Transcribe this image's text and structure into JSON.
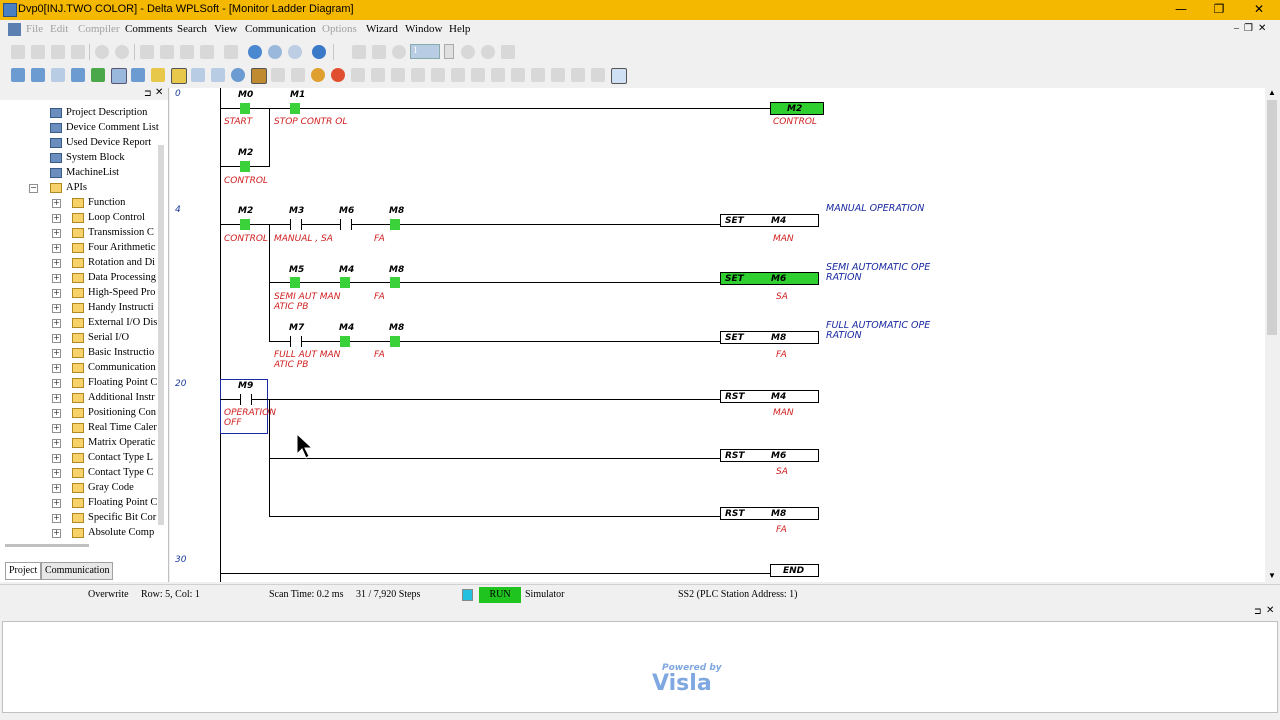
{
  "window": {
    "title": "Dvp0[INJ.TWO COLOR] - Delta WPLSoft - [Monitor Ladder Diagram]",
    "minimize": "—",
    "maximize": "❐",
    "close": "✕"
  },
  "menu": {
    "file": "File",
    "edit": "Edit",
    "compiler": "Compiler",
    "comments": "Comments",
    "search": "Search",
    "view": "View",
    "communication": "Communication",
    "options": "Options",
    "wizard": "Wizard",
    "window": "Window",
    "help": "Help"
  },
  "toolbar": {
    "step_value": "1"
  },
  "tree": {
    "items": [
      {
        "label": "Project Description"
      },
      {
        "label": "Device Comment List"
      },
      {
        "label": "Used Device Report"
      },
      {
        "label": "System Block"
      },
      {
        "label": "MachineList"
      },
      {
        "label": "APIs"
      },
      {
        "label": "Function"
      },
      {
        "label": "Loop Control"
      },
      {
        "label": "Transmission C"
      },
      {
        "label": "Four Arithmetic"
      },
      {
        "label": "Rotation and Di"
      },
      {
        "label": "Data Processing"
      },
      {
        "label": "High-Speed Pro"
      },
      {
        "label": "Handy Instructi"
      },
      {
        "label": "External I/O Dis"
      },
      {
        "label": "Serial I/O"
      },
      {
        "label": "Basic Instructio"
      },
      {
        "label": "Communication"
      },
      {
        "label": "Floating Point C"
      },
      {
        "label": "Additional Instr"
      },
      {
        "label": "Positioning Con"
      },
      {
        "label": "Real Time Caler"
      },
      {
        "label": "Matrix Operatic"
      },
      {
        "label": "Contact Type L"
      },
      {
        "label": "Contact Type C"
      },
      {
        "label": "Gray Code"
      },
      {
        "label": "Floating Point C"
      },
      {
        "label": "Specific Bit Cor"
      },
      {
        "label": "Absolute Comp"
      }
    ],
    "tab_project": "Project",
    "tab_communication": "Communication"
  },
  "ladder": {
    "row_numbers": {
      "r0": "0",
      "r4": "4",
      "r20": "20",
      "r30": "30"
    },
    "devices": {
      "m0": "M0",
      "m1": "M1",
      "m2a": "M2",
      "m2b": "M2",
      "m3": "M3",
      "m6a": "M6",
      "m8a": "M8",
      "m5": "M5",
      "m4a": "M4",
      "m8b": "M8",
      "m7": "M7",
      "m4b": "M4",
      "m8c": "M8",
      "m9": "M9"
    },
    "comments": {
      "start": "START",
      "stop": "STOP CONTR OL",
      "control1": "CONTROL",
      "control2": "CONTROL",
      "manual_sa": "MANUAL , SA",
      "fa1": "FA",
      "semi": "SEMI AUT MAN ATIC PB",
      "fa2": "FA",
      "full": "FULL AUT MAN ATIC PB",
      "fa3": "FA",
      "opoff": "OPERATION OFF"
    },
    "coils": {
      "c1_dev": "M2",
      "c1_cmt": "CONTROL",
      "c2_op": "SET",
      "c2_dev": "M4",
      "c2_cmt": "MAN",
      "c3_op": "SET",
      "c3_dev": "M6",
      "c3_cmt": "SA",
      "c4_op": "SET",
      "c4_dev": "M8",
      "c4_cmt": "FA",
      "c5_op": "RST",
      "c5_dev": "M4",
      "c5_cmt": "MAN",
      "c6_op": "RST",
      "c6_dev": "M6",
      "c6_cmt": "SA",
      "c7_op": "RST",
      "c7_dev": "M8",
      "c7_cmt": "FA",
      "end": "END"
    },
    "net_comments": {
      "manual": "MANUAL OPERATION",
      "semi": "SEMI AUTOMATIC OPE RATION",
      "full": "FULL AUTOMATIC OPE RATION"
    }
  },
  "status": {
    "mode": "Overwrite",
    "position": "Row: 5, Col: 1",
    "scan_time": "Scan Time: 0.2 ms",
    "steps": "31 / 7,920 Steps",
    "run": "RUN",
    "simulator": "Simulator",
    "station": "SS2 (PLC Station Address: 1)"
  },
  "watermark": {
    "powered_by": "Powered by",
    "brand": "Visla"
  },
  "colors": {
    "title_bar": "#f5b800",
    "contact_on": "#3ad13a",
    "comment_red": "#d02020",
    "comment_blue": "#1a2aa0"
  }
}
